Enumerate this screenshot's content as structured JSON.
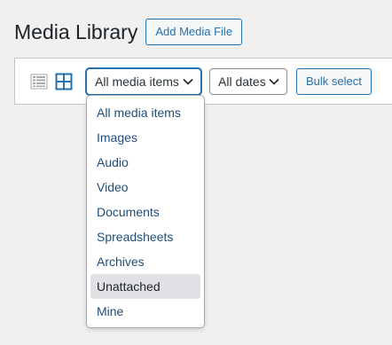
{
  "header": {
    "title": "Media Library",
    "add_button_label": "Add Media File"
  },
  "toolbar": {
    "list_view_icon": "list-view-icon",
    "grid_view_icon": "grid-view-icon",
    "type_filter": {
      "selected": "All media items"
    },
    "date_filter": {
      "selected": "All dates"
    },
    "bulk_select_label": "Bulk select"
  },
  "dropdown": {
    "options": [
      {
        "label": "All media items"
      },
      {
        "label": "Images"
      },
      {
        "label": "Audio"
      },
      {
        "label": "Video"
      },
      {
        "label": "Documents"
      },
      {
        "label": "Spreadsheets"
      },
      {
        "label": "Archives"
      },
      {
        "label": "Unattached"
      },
      {
        "label": "Mine"
      }
    ],
    "hovered": "Unattached"
  },
  "colors": {
    "accent": "#2271b1",
    "background": "#f0f0f1",
    "hover": "#e2e2e6"
  }
}
